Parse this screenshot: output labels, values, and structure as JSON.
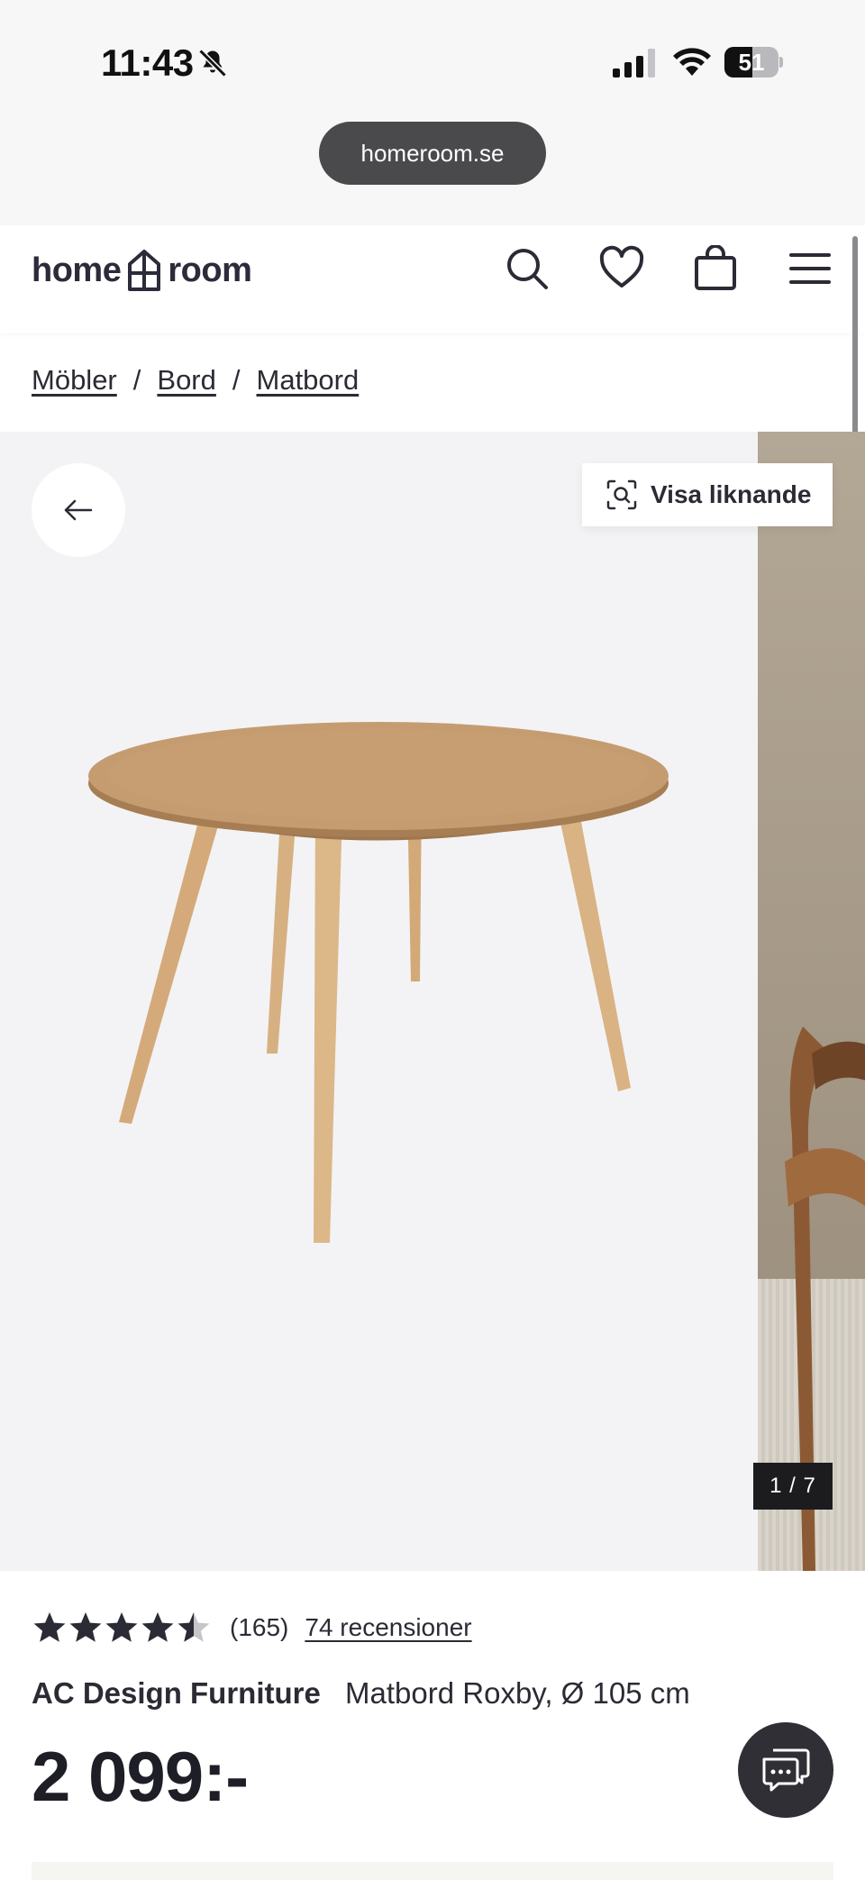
{
  "status_bar": {
    "time": "11:43",
    "battery": "51",
    "battery_level": 0.51
  },
  "browser": {
    "url": "homeroom.se"
  },
  "header": {
    "logo_left": "home",
    "logo_right": "room",
    "icons": [
      "search-icon",
      "heart-icon",
      "bag-icon",
      "menu-icon"
    ]
  },
  "breadcrumb": {
    "items": [
      "Möbler",
      "Bord",
      "Matbord"
    ],
    "separator": "/"
  },
  "gallery": {
    "similar_label": "Visa liknande",
    "counter": "1 / 7",
    "current_image": 1,
    "total_images": 7
  },
  "product": {
    "rating": 4.5,
    "rating_max": 5,
    "review_count": "(165)",
    "reviews_link": "74 recensioner",
    "brand": "AC Design Furniture",
    "name": "Matbord Roxby, Ø 105 cm",
    "price": "2 099:-"
  },
  "colors": {
    "text": "#2b2b35",
    "gallery_bg": "#f3f3f5",
    "wood": "#c9a47c",
    "chat_bg": "#2f2f35"
  }
}
